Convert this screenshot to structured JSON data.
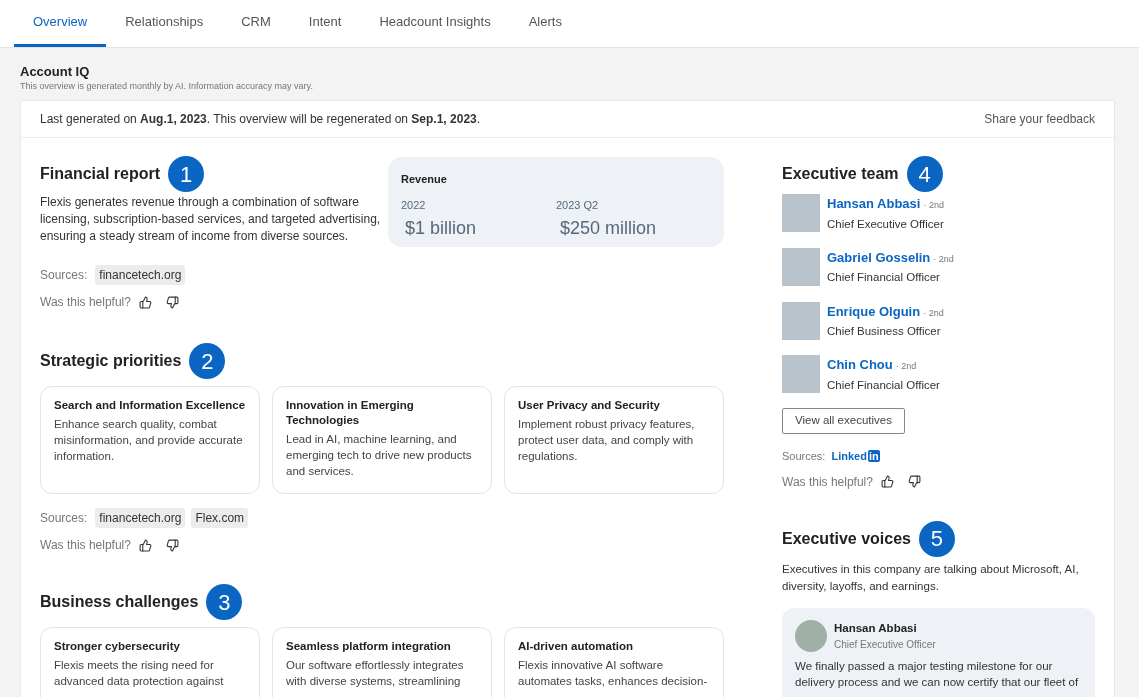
{
  "tabs": [
    {
      "label": "Overview",
      "selected": true
    },
    {
      "label": "Relationships",
      "selected": false
    },
    {
      "label": "CRM",
      "selected": false
    },
    {
      "label": "Intent",
      "selected": false
    },
    {
      "label": "Headcount Insights",
      "selected": false
    },
    {
      "label": "Alerts",
      "selected": false
    }
  ],
  "header": {
    "title": "Account IQ",
    "subtitle": "This overview is generated monthly by AI. Information accuracy may vary."
  },
  "notice": {
    "text": "Last generated on **Aug.1, 2023**. This overview will be regenerated on **Sep.1, 2023**.",
    "feedback_link": "Share your feedback"
  },
  "financial_report": {
    "title": "Financial report",
    "badge": "1",
    "description": "Flexis generates revenue through a combination of software licensing, subscription-based services, and targeted advertising, ensuring a steady stream of income from diverse sources.",
    "revenue": {
      "label": "Revenue",
      "items": [
        {
          "period": "2022",
          "value": "$1 billion"
        },
        {
          "period": "2023 Q2",
          "value": "$250 million"
        }
      ]
    },
    "sources_label": "Sources:",
    "sources": [
      "financetech.org"
    ],
    "helpful_label": "Was this helpful?"
  },
  "strategic_priorities": {
    "title": "Strategic priorities",
    "badge": "2",
    "cards": [
      {
        "title": "Search and Information Excellence",
        "text": "Enhance search quality, combat misinformation, and provide accurate information."
      },
      {
        "title": "Innovation in Emerging Technologies",
        "text": "Lead in AI, machine learning, and emerging tech to drive new products and services."
      },
      {
        "title": "User Privacy and Security",
        "text": "Implement robust privacy features, protect user data, and comply with regulations."
      }
    ],
    "sources_label": "Sources:",
    "sources": [
      "financetech.org",
      "Flex.com"
    ],
    "helpful_label": "Was this helpful?"
  },
  "business_challenges": {
    "title": "Business challenges",
    "badge": "3",
    "cards": [
      {
        "title": "Stronger cybersecurity",
        "text": "Flexis meets the rising need for advanced data protection against"
      },
      {
        "title": "Seamless platform integration",
        "text": "Our software effortlessly integrates with diverse systems, streamlining"
      },
      {
        "title": "AI-driven automation",
        "text": "Flexis innovative AI software automates tasks, enhances decision-"
      }
    ]
  },
  "executive_team": {
    "title": "Executive team",
    "badge": "4",
    "executives": [
      {
        "name": "Hansan Abbasi",
        "degree": "· 2nd",
        "role": "Chief Executive Officer"
      },
      {
        "name": "Gabriel Gosselin",
        "degree": "· 2nd",
        "role": "Chief Financial Officer"
      },
      {
        "name": "Enrique Olguin",
        "degree": "· 2nd",
        "role": "Chief Business Officer"
      },
      {
        "name": "Chin Chou",
        "degree": "· 2nd",
        "role": "Chief Financial Officer"
      }
    ],
    "view_all_button": "View all executives",
    "sources_label": "Sources:",
    "source_logo": {
      "text": "Linked",
      "mark": "in"
    },
    "helpful_label": "Was this helpful?"
  },
  "executive_voices": {
    "title": "Executive voices",
    "badge": "5",
    "summary": "Executives in this company are talking about Microsoft, AI, diversity, layoffs, and earnings.",
    "post": {
      "name": "Hansan Abbasi",
      "role": "Chief Executive Officer",
      "text": "We finally passed a major testing milestone for our delivery process and we can now certify that our fleet of"
    }
  }
}
